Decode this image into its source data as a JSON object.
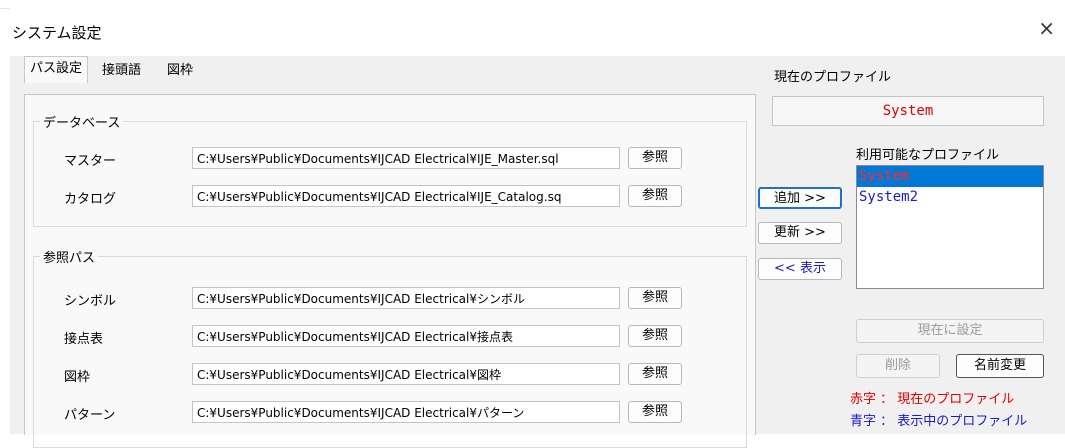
{
  "window": {
    "title": "システム設定",
    "close_glyph": "×"
  },
  "tabs": [
    {
      "label": "パス設定",
      "active": true
    },
    {
      "label": "接頭語",
      "active": false
    },
    {
      "label": "図枠",
      "active": false
    }
  ],
  "database_group": {
    "legend": "データベース",
    "rows": [
      {
        "label": "マスター",
        "path": "C:¥Users¥Public¥Documents¥IJCAD Electrical¥IJE_Master.sql",
        "button": "参照"
      },
      {
        "label": "カタログ",
        "path": "C:¥Users¥Public¥Documents¥IJCAD Electrical¥IJE_Catalog.sq",
        "button": "参照"
      }
    ]
  },
  "reference_group": {
    "legend": "参照パス",
    "rows": [
      {
        "label": "シンボル",
        "path": "C:¥Users¥Public¥Documents¥IJCAD Electrical¥シンボル",
        "button": "参照"
      },
      {
        "label": "接点表",
        "path": "C:¥Users¥Public¥Documents¥IJCAD Electrical¥接点表",
        "button": "参照"
      },
      {
        "label": "図枠",
        "path": "C:¥Users¥Public¥Documents¥IJCAD Electrical¥図枠",
        "button": "参照"
      },
      {
        "label": "パターン",
        "path": "C:¥Users¥Public¥Documents¥IJCAD Electrical¥パターン",
        "button": "参照"
      }
    ]
  },
  "profile": {
    "current_label": "現在のプロファイル",
    "current_value": "System",
    "available_label": "利用可能なプロファイル",
    "list": [
      {
        "name": "System",
        "selected": true
      },
      {
        "name": "System2",
        "selected": false
      }
    ],
    "add_button": "追加 >>",
    "update_button": "更新 >>",
    "show_button": "<< 表示",
    "set_current_button": "現在に設定",
    "delete_button": "削除",
    "rename_button": "名前変更",
    "note_red": "赤字 ： 現在のプロファイル",
    "note_blue": "青字 ： 表示中のプロファイル"
  },
  "colors": {
    "accent": "#0078d7",
    "red_text": "#e60000",
    "blue_text": "#1a1acc"
  }
}
